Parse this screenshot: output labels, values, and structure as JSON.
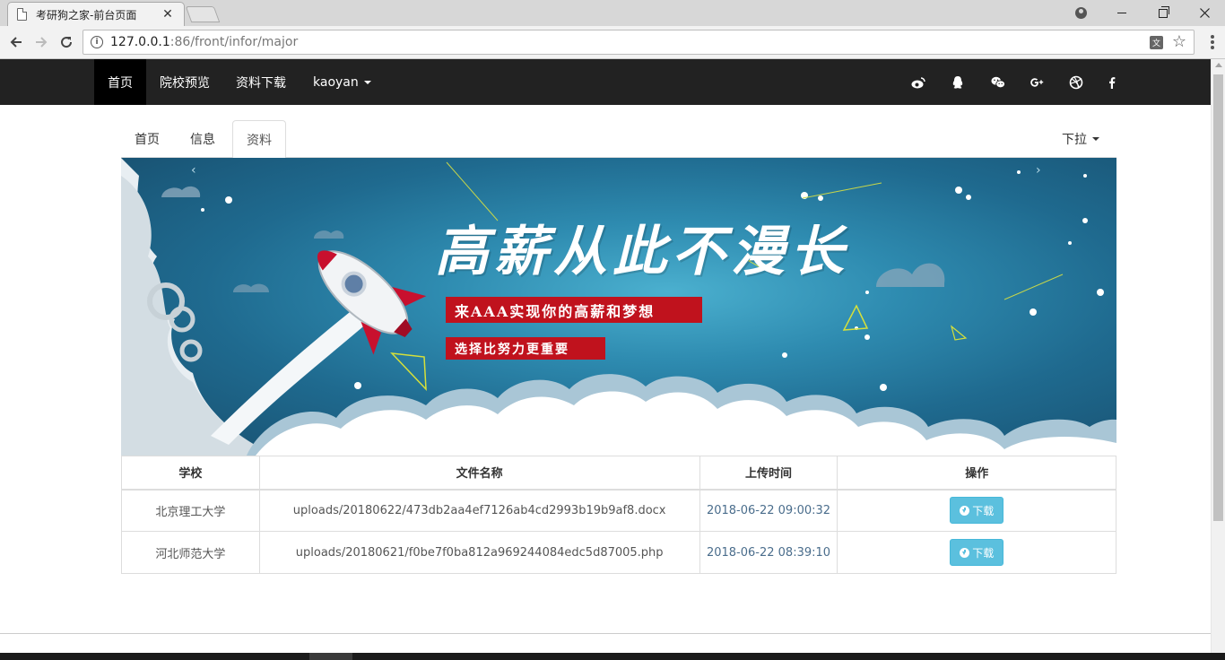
{
  "browser": {
    "tab_title": "考研狗之家-前台页面",
    "tab_close": "✕",
    "url_host": "127.0.0.1",
    "url_path": ":86/front/infor/major"
  },
  "topnav": {
    "items": [
      "首页",
      "院校预览",
      "资料下载",
      "kaoyan"
    ],
    "social_icons": [
      "weibo-icon",
      "qq-icon",
      "wechat-icon",
      "google-plus-icon",
      "dribbble-icon",
      "facebook-icon"
    ]
  },
  "subtabs": {
    "items": [
      "首页",
      "信息",
      "资料"
    ],
    "active": "资料",
    "dropdown": "下拉"
  },
  "banner": {
    "title": "高薪从此不漫长",
    "line1": "来AAA实现你的高薪和梦想",
    "line2": "选择比努力更重要",
    "prev": "‹",
    "next": "›"
  },
  "table": {
    "headers": [
      "学校",
      "文件名称",
      "上传时间",
      "操作"
    ],
    "rows": [
      {
        "school": "北京理工大学",
        "file": "uploads/20180622/473db2aa4ef7126ab4cd2993b19b9af8.docx",
        "time": "2018-06-22 09:00:32",
        "action": "下载"
      },
      {
        "school": "河北师范大学",
        "file": "uploads/20180621/f0be7f0ba812a969244084edc5d87005.php",
        "time": "2018-06-22 08:39:10",
        "action": "下载"
      }
    ]
  },
  "colors": {
    "navbar": "#222222",
    "nav_active": "#000000",
    "banner_red": "#c0121d",
    "button_info": "#5bc0de"
  }
}
